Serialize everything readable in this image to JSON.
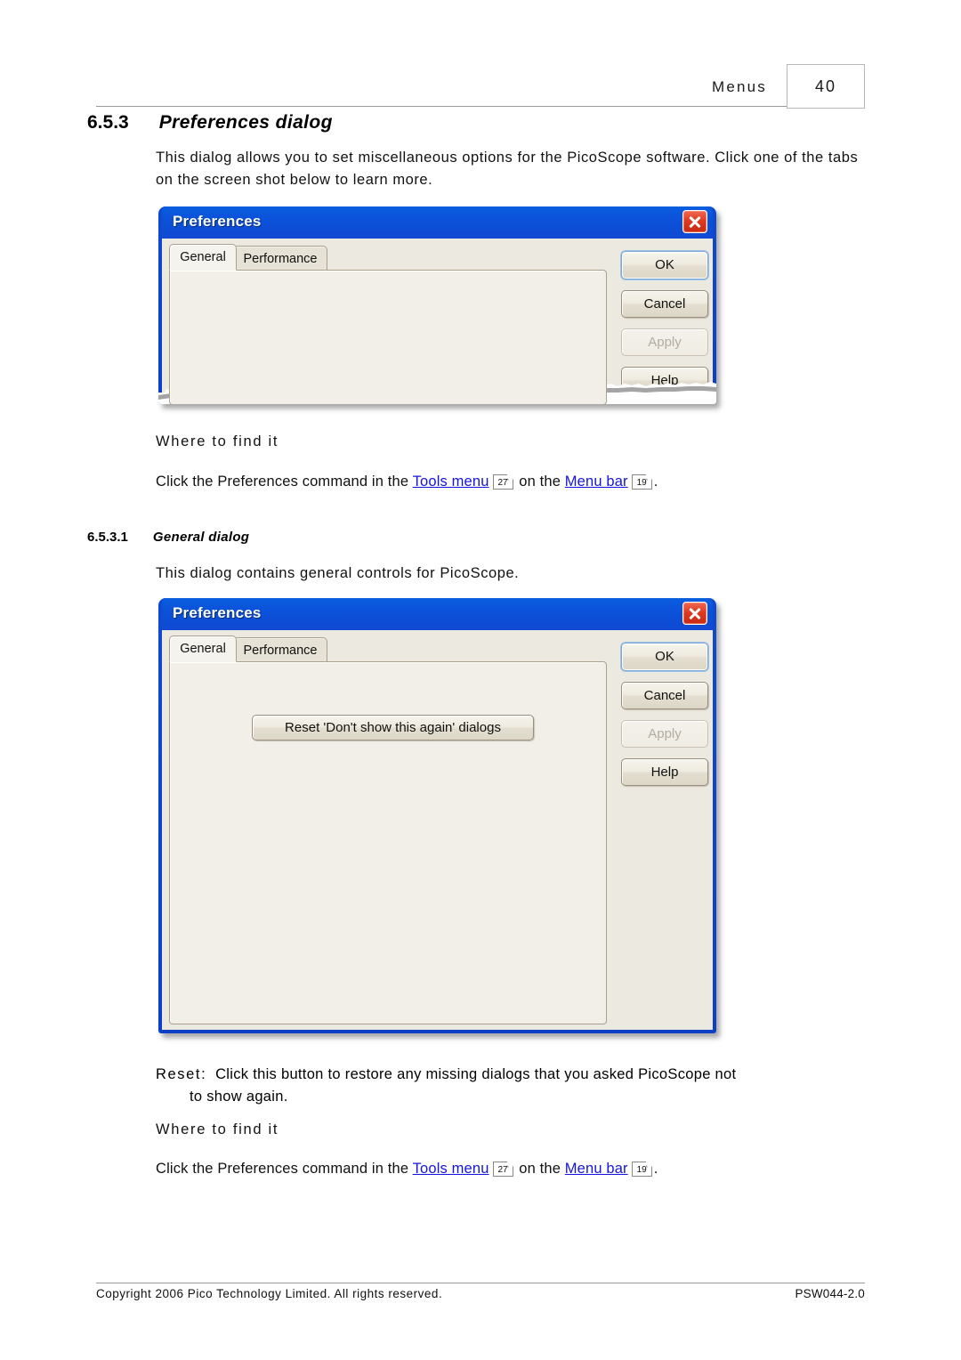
{
  "header": {
    "title": "Menus",
    "page_number": "40"
  },
  "sections": {
    "s1": {
      "number": "6.5.3",
      "title": "Preferences dialog",
      "intro": "This dialog allows you to set miscellaneous options for the PicoScope software. Click one of the tabs on the screen shot below to learn more."
    },
    "s2": {
      "number": "6.5.3.1",
      "title": "General dialog",
      "intro": "This dialog contains general controls for PicoScope."
    }
  },
  "where_to_find": {
    "heading": "Where to find it",
    "prefix": "Click the Preferences command in the ",
    "link1": "Tools menu",
    "ref1": "27",
    "middle": " on the ",
    "link2": "Menu bar",
    "ref2": "19",
    "suffix": "."
  },
  "reset_description": {
    "label": "Reset:",
    "line1": "Click this button to restore any missing dialogs that you asked PicoScope not",
    "line2": "to show again."
  },
  "dialog": {
    "title": "Preferences",
    "close_icon": "close-icon",
    "tabs": [
      {
        "label": "General",
        "active": true
      },
      {
        "label": "Performance",
        "active": false
      }
    ],
    "buttons": [
      {
        "label": "OK",
        "state": "focused"
      },
      {
        "label": "Cancel",
        "state": "normal"
      },
      {
        "label": "Apply",
        "state": "disabled"
      },
      {
        "label": "Help",
        "state": "normal"
      }
    ],
    "reset_button": "Reset 'Don't show this again' dialogs"
  },
  "footer": {
    "copyright": "Copyright 2006 Pico Technology Limited. All rights reserved.",
    "doc_id": "PSW044-2.0"
  },
  "colors": {
    "link": "#1414e0",
    "title_bar": "#0b4fd6",
    "close_button": "#d8381c",
    "dialog_face": "#ece9e0",
    "panel_face": "#f1efe7",
    "rule": "#9a9a9a"
  }
}
